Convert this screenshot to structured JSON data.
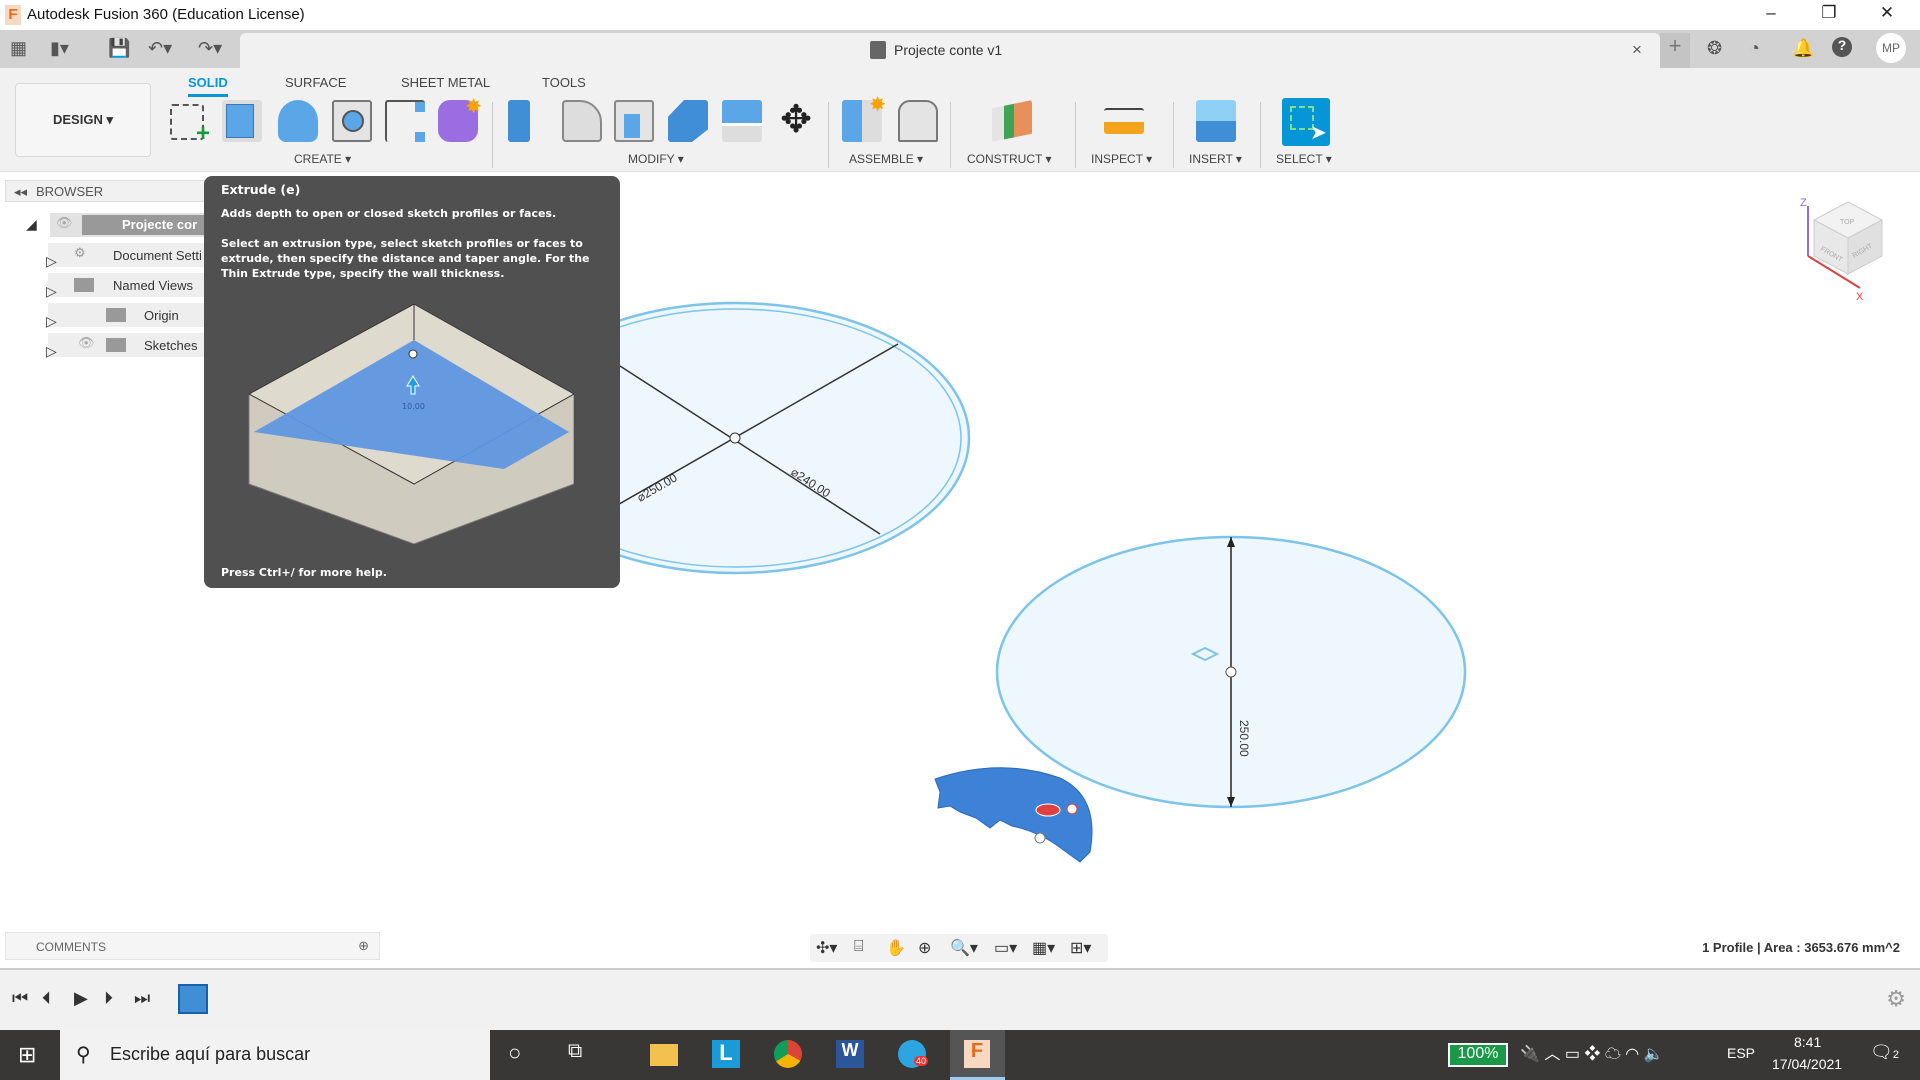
{
  "window": {
    "title": "Autodesk Fusion 360 (Education License)",
    "controls": [
      "minimize",
      "restore",
      "close"
    ]
  },
  "document_tab": {
    "title": "Projecte conte v1",
    "close": "×"
  },
  "header_right": {
    "icons": [
      "plus-icon",
      "extensions-icon",
      "job-status-icon",
      "notifications-icon",
      "help-icon"
    ],
    "user_initials": "MP"
  },
  "ribbon": {
    "workspace": "DESIGN ▾",
    "tabs": [
      {
        "label": "SOLID",
        "active": true
      },
      {
        "label": "SURFACE"
      },
      {
        "label": "SHEET METAL"
      },
      {
        "label": "TOOLS"
      }
    ],
    "groups": [
      {
        "label": "CREATE ▾"
      },
      {
        "label": "MODIFY ▾"
      },
      {
        "label": "ASSEMBLE ▾"
      },
      {
        "label": "CONSTRUCT ▾"
      },
      {
        "label": "INSPECT ▾"
      },
      {
        "label": "INSERT ▾"
      },
      {
        "label": "SELECT ▾"
      }
    ]
  },
  "browser": {
    "title": "BROWSER",
    "items": [
      {
        "label": "Projecte cor"
      },
      {
        "label": "Document Setti"
      },
      {
        "label": "Named Views"
      },
      {
        "label": "Origin"
      },
      {
        "label": "Sketches"
      }
    ]
  },
  "tooltip": {
    "title": "Extrude (e)",
    "summary": "Adds depth to open or closed sketch profiles or faces.",
    "description": "Select an extrusion type, select sketch profiles or faces to extrude, then specify the distance and taper angle. For the Thin Extrude type, specify the wall thickness.",
    "image_dimension": "10.00",
    "footer": "Press Ctrl+/ for more help."
  },
  "viewport": {
    "dimensions": {
      "d1": "⌀250.00",
      "d2": "⌀240.00",
      "d3": "250.00"
    },
    "viewcube": {
      "top": "TOP",
      "front": "FRONT",
      "right": "RIGHT",
      "axis_z": "Z",
      "axis_x": "X"
    },
    "colors": {
      "sketch_fill": "#eef7fd",
      "sketch_line": "#7cc4e8",
      "profile": "#3d82d6"
    }
  },
  "comments": {
    "label": "COMMENTS"
  },
  "status": {
    "text": "1 Profile | Area : 3653.676 mm^2"
  },
  "taskbar": {
    "search_placeholder": "Escribe aquí para buscar",
    "battery": "100%",
    "language": "ESP",
    "time": "8:41",
    "date": "17/04/2021",
    "notifications": "2",
    "telegram_badge": "40"
  }
}
